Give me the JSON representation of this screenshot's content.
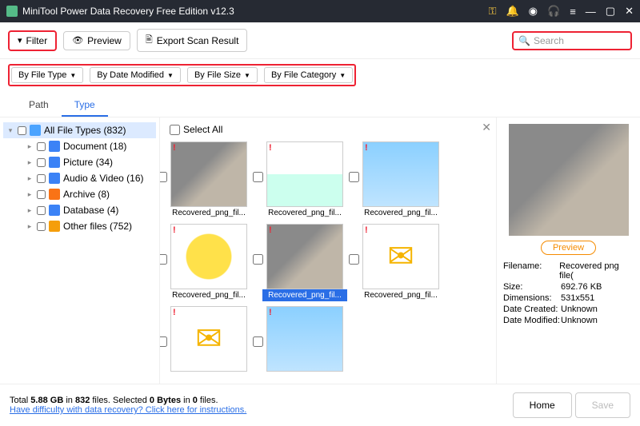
{
  "title": "MiniTool Power Data Recovery Free Edition v12.3",
  "toolbar": {
    "filter": "Filter",
    "preview": "Preview",
    "export": "Export Scan Result",
    "search_placeholder": "Search"
  },
  "chips": [
    "By File Type",
    "By Date Modified",
    "By File Size",
    "By File Category"
  ],
  "tabs": {
    "path": "Path",
    "type": "Type"
  },
  "tree": [
    {
      "label": "All File Types (832)",
      "icon": "ic-all",
      "expanded": true,
      "hl": true
    },
    {
      "label": "Document (18)",
      "icon": "ic-doc"
    },
    {
      "label": "Picture (34)",
      "icon": "ic-pic"
    },
    {
      "label": "Audio & Video (16)",
      "icon": "ic-av"
    },
    {
      "label": "Archive (8)",
      "icon": "ic-arc"
    },
    {
      "label": "Database (4)",
      "icon": "ic-db"
    },
    {
      "label": "Other files (752)",
      "icon": "ic-oth"
    }
  ],
  "selectall": "Select All",
  "thumbs": [
    {
      "label": "Recovered_png_fil...",
      "cls": "cat1"
    },
    {
      "label": "Recovered_png_fil...",
      "cls": "mirror"
    },
    {
      "label": "Recovered_png_fil...",
      "cls": "sky"
    },
    {
      "label": "Recovered_png_fil...",
      "cls": "pika"
    },
    {
      "label": "Recovered_png_fil...",
      "cls": "cat1",
      "selected": true
    },
    {
      "label": "Recovered_png_fil...",
      "cls": "env"
    },
    {
      "label": "",
      "cls": "env"
    },
    {
      "label": "",
      "cls": "sky"
    }
  ],
  "preview": {
    "button": "Preview",
    "meta": [
      {
        "k": "Filename:",
        "v": "Recovered png file("
      },
      {
        "k": "Size:",
        "v": "692.76 KB"
      },
      {
        "k": "Dimensions:",
        "v": "531x551"
      },
      {
        "k": "Date Created:",
        "v": "Unknown"
      },
      {
        "k": "Date Modified:",
        "v": "Unknown"
      }
    ]
  },
  "footer": {
    "total_pre": "Total ",
    "total_size": "5.88 GB",
    "in": " in ",
    "total_files": "832",
    "files_lbl": " files. ",
    "sel_pre": "Selected ",
    "sel_bytes": "0 Bytes",
    "in2": " in ",
    "sel_files": "0",
    "files_lbl2": " files.",
    "help": "Have difficulty with data recovery? Click here for instructions.",
    "home": "Home",
    "save": "Save"
  }
}
